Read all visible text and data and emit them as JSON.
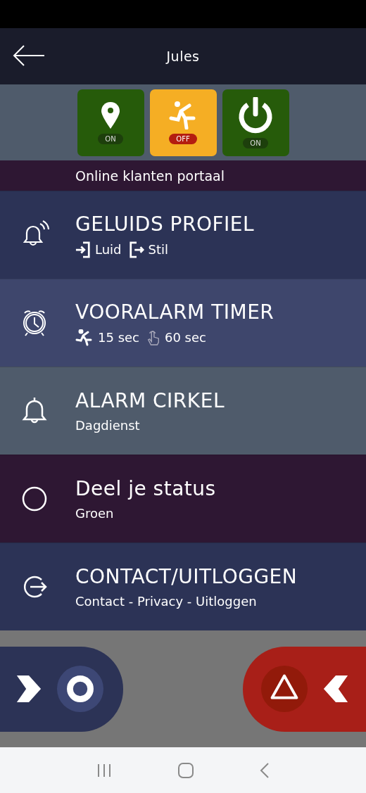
{
  "header": {
    "title": "Jules"
  },
  "toggles": [
    {
      "kind": "location",
      "on": true,
      "label": "ON"
    },
    {
      "kind": "fall",
      "on": false,
      "label": "OFF"
    },
    {
      "kind": "power",
      "on": true,
      "label": "ON"
    }
  ],
  "partial_row": {
    "subtitle": "Online klanten portaal"
  },
  "menu": [
    {
      "kind": "sound",
      "color": "#2c3356",
      "title": "GELUIDS PROFIEL",
      "details": [
        {
          "kind": "enter",
          "text": "Luid"
        },
        {
          "kind": "exit",
          "text": "Stil"
        }
      ]
    },
    {
      "kind": "timer",
      "color": "#3e466c",
      "title": "VOORALARM TIMER",
      "details": [
        {
          "kind": "fall",
          "text": "15 sec"
        },
        {
          "kind": "hand",
          "text": "60 sec"
        }
      ]
    },
    {
      "kind": "alarm",
      "color": "#4f5b6b",
      "title": "ALARM CIRKEL",
      "subtitle": "Dagdienst"
    },
    {
      "kind": "status",
      "color": "#2e1733",
      "title": "Deel je status",
      "subtitle": "Groen"
    },
    {
      "kind": "logout",
      "color": "#2c3356",
      "title": "CONTACT/UITLOGGEN",
      "subtitle": "Contact - Privacy - Uitloggen"
    }
  ]
}
